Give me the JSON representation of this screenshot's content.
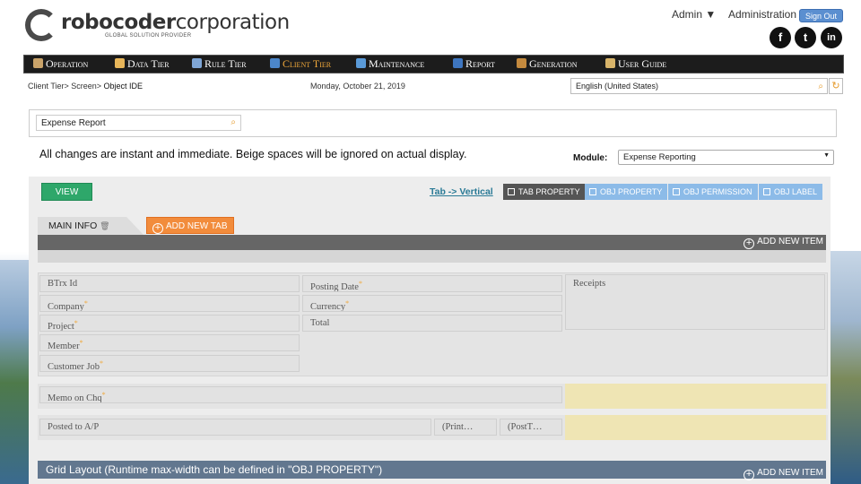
{
  "header": {
    "logo_robocoder": "robocoder",
    "logo_corporation": "corporation",
    "logo_tagline": "GLOBAL SOLUTION PROVIDER",
    "admin_label": "Admin ▼",
    "administration_label": "Administration",
    "signout_label": "Sign Out",
    "social": [
      "f",
      "t",
      "in"
    ]
  },
  "nav": {
    "items": [
      {
        "label": "Operation",
        "active": false
      },
      {
        "label": "Data Tier",
        "active": false
      },
      {
        "label": "Rule Tier",
        "active": false
      },
      {
        "label": "Client Tier",
        "active": true
      },
      {
        "label": "Maintenance",
        "active": false
      },
      {
        "label": "Report",
        "active": false
      },
      {
        "label": "Generation",
        "active": false
      },
      {
        "label": "User Guide",
        "active": false
      }
    ]
  },
  "breadcrumb": {
    "path": "Client Tier> Screen> ",
    "current": "Object IDE"
  },
  "date": "Monday, October 21, 2019",
  "language": {
    "value": "English (United States)"
  },
  "screen": {
    "value": "Expense Report"
  },
  "notice": "All changes are instant and immediate. Beige spaces will be ignored on actual display.",
  "module": {
    "label": "Module:",
    "value": "Expense Reporting"
  },
  "toolbar": {
    "view_label": "VIEW",
    "tab_vertical_label": "Tab -> Vertical",
    "tabs": [
      "TAB PROPERTY",
      "OBJ PROPERTY",
      "OBJ PERMISSION",
      "OBJ LABEL"
    ]
  },
  "tabs": {
    "main_label": "MAIN INFO",
    "add_tab_label": "ADD NEW TAB",
    "add_item_label": "ADD NEW ITEM"
  },
  "fields": {
    "btrx_id": "BTrx Id",
    "company": "Company",
    "project": "Project",
    "member": "Member",
    "customer_job": "Customer Job",
    "posting_date": "Posting Date",
    "currency": "Currency",
    "total": "Total",
    "receipts": "Receipts",
    "memo": "Memo on Chq",
    "posted_ap": "Posted to A/P",
    "print": "(Print…",
    "postt": "(PostT…"
  },
  "grid": {
    "title": "Grid Layout (Runtime max-width can be defined in \"OBJ PROPERTY\")",
    "add_item_label": "ADD NEW ITEM"
  },
  "colors": {
    "accent_orange": "#f28c3c",
    "view_green": "#2ea76a",
    "tab_blue": "#8cbbe8",
    "beige": "#efe5b4"
  }
}
